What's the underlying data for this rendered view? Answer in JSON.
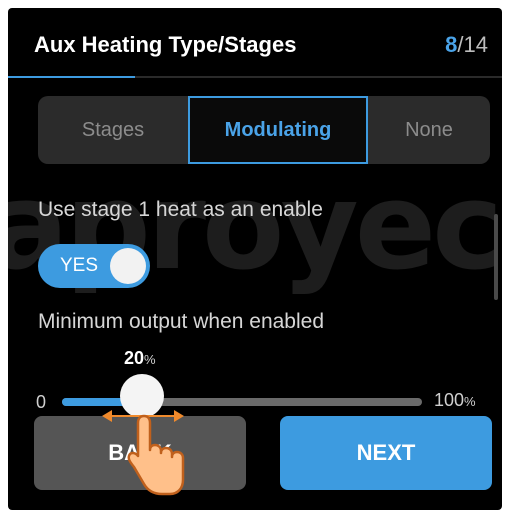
{
  "header": {
    "title": "Aux Heating Type/Stages",
    "step_current": "8",
    "step_total": "/14",
    "progress_fraction": 0.57
  },
  "segmented": {
    "options": [
      "Stages",
      "Modulating",
      "None"
    ],
    "selected": "Modulating"
  },
  "watermark": "aproyec",
  "stage1_enable": {
    "label": "Use stage 1 heat as an enable",
    "toggle_text": "YES",
    "on": true
  },
  "min_output": {
    "label": "Minimum output when enabled",
    "value": "20",
    "value_unit": "%",
    "min_label": "0",
    "max_label": "100",
    "max_unit": "%"
  },
  "buttons": {
    "back": "BACK",
    "next": "NEXT"
  },
  "colors": {
    "accent": "#3d9be0",
    "background": "#000000",
    "secondary_button": "#555555"
  },
  "icons": {
    "drag_hint": "hand-pointer-icon",
    "drag_arrows": "left-right-arrows-icon"
  }
}
